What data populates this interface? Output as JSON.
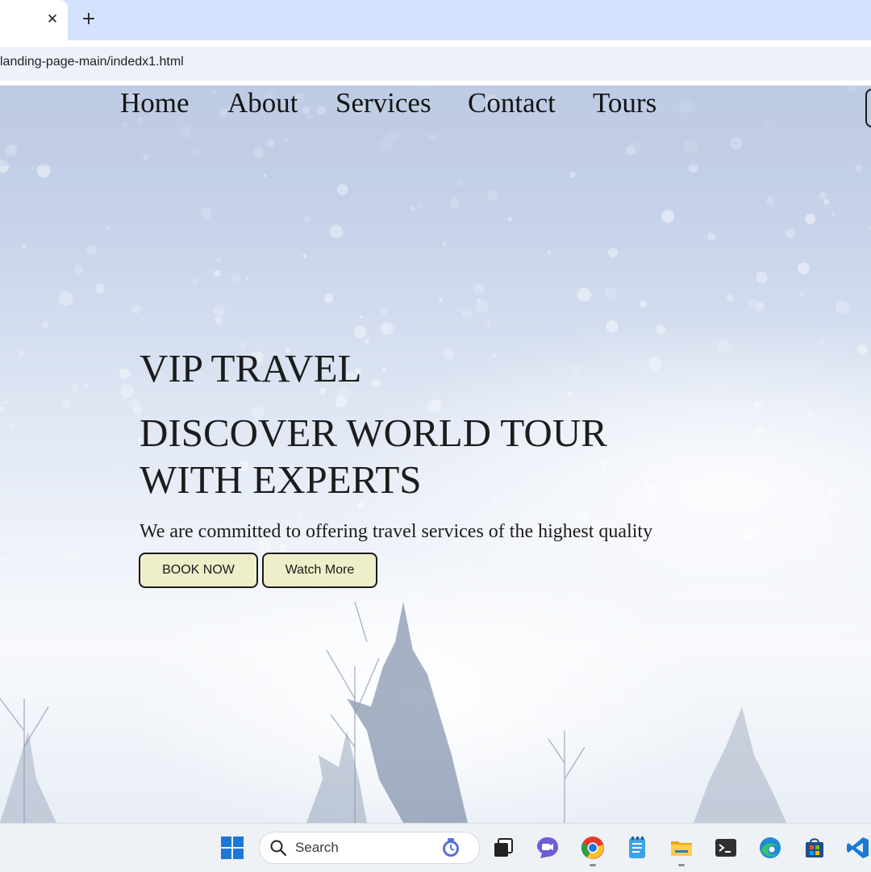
{
  "browser": {
    "tab_close_glyph": "✕",
    "new_tab_glyph": "+",
    "url": "landing-page-main/indedx1.html"
  },
  "nav": {
    "links": [
      "Home",
      "About",
      "Services",
      "Contact",
      "Tours"
    ]
  },
  "hero": {
    "kicker": "VIP TRAVEL",
    "title": "DISCOVER WORLD TOUR WITH EXPERTS",
    "subtitle": "We are committed to offering travel services of the highest quality",
    "primary_button": "BOOK NOW",
    "secondary_button": "Watch More"
  },
  "taskbar": {
    "search_placeholder": "Search",
    "icons": [
      "windows-start-icon",
      "search-icon",
      "copilot-icon",
      "task-view-icon",
      "chat-icon",
      "chrome-icon",
      "notepad-icon",
      "file-explorer-icon",
      "terminal-icon",
      "edge-icon",
      "store-icon",
      "vscode-icon"
    ]
  },
  "colors": {
    "tabstrip": "#d3e3fd",
    "button_fill": "#eeeeca",
    "text": "#1c1c1c"
  }
}
